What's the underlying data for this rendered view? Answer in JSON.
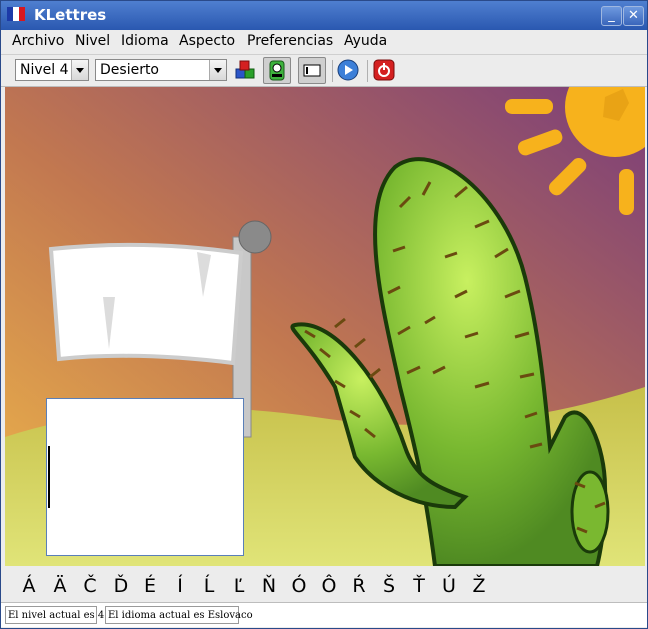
{
  "window": {
    "title": "KLettres"
  },
  "menubar": {
    "items": [
      {
        "label": "Archivo",
        "name": "menu-archivo"
      },
      {
        "label": "Nivel",
        "name": "menu-nivel"
      },
      {
        "label": "Idioma",
        "name": "menu-idioma"
      },
      {
        "label": "Aspecto",
        "name": "menu-aspecto"
      },
      {
        "label": "Preferencias",
        "name": "menu-preferencias"
      },
      {
        "label": "Ayuda",
        "name": "menu-ayuda"
      }
    ]
  },
  "toolbar": {
    "level_select": "Nivel 4",
    "theme_select": "Desierto",
    "icons": [
      "blocks-icon",
      "grown-up-icon",
      "menubar-toggle-icon",
      "play-icon",
      "quit-icon"
    ]
  },
  "letters": [
    "Á",
    "Ä",
    "Č",
    "Ď",
    "É",
    "Í",
    "Ĺ",
    "Ľ",
    "Ň",
    "Ó",
    "Ô",
    "Ŕ",
    "Š",
    "Ť",
    "Ú",
    "Ž"
  ],
  "statusbar": {
    "level_text": "El nivel actual es 4",
    "language_text": "El idioma actual es Eslovaco"
  },
  "colors": {
    "title_bar": "#3a67be",
    "sky_top": "#8a4a7a",
    "sun": "#f7b21c",
    "cactus": "#6aa62e"
  }
}
